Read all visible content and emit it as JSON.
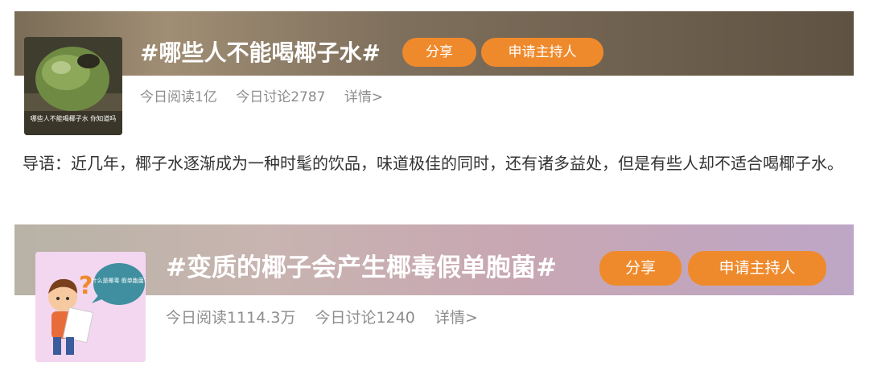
{
  "topics": [
    {
      "title": "#哪些人不能喝椰子水#",
      "share_label": "分享",
      "host_label": "申请主持人",
      "reads": "今日阅读1亿",
      "discussions": "今日讨论2787",
      "detail_label": "详情>",
      "thumb_caption": "哪些人不能喝椰子水 你知道吗"
    },
    {
      "title": "#变质的椰子会产生椰毒假单胞菌#",
      "share_label": "分享",
      "host_label": "申请主持人",
      "reads": "今日阅读1114.3万",
      "discussions": "今日讨论1240",
      "detail_label": "详情>",
      "thumb_bubble": "什么是椰毒 假单胞菌?"
    }
  ],
  "intro": "导语：近几年，椰子水逐渐成为一种时髦的饮品，味道极佳的同时，还有诸多益处，但是有些人却不适合喝椰子水。",
  "colors": {
    "accent_orange": "#ef8a2c",
    "stats_gray": "#8d8d8d"
  }
}
